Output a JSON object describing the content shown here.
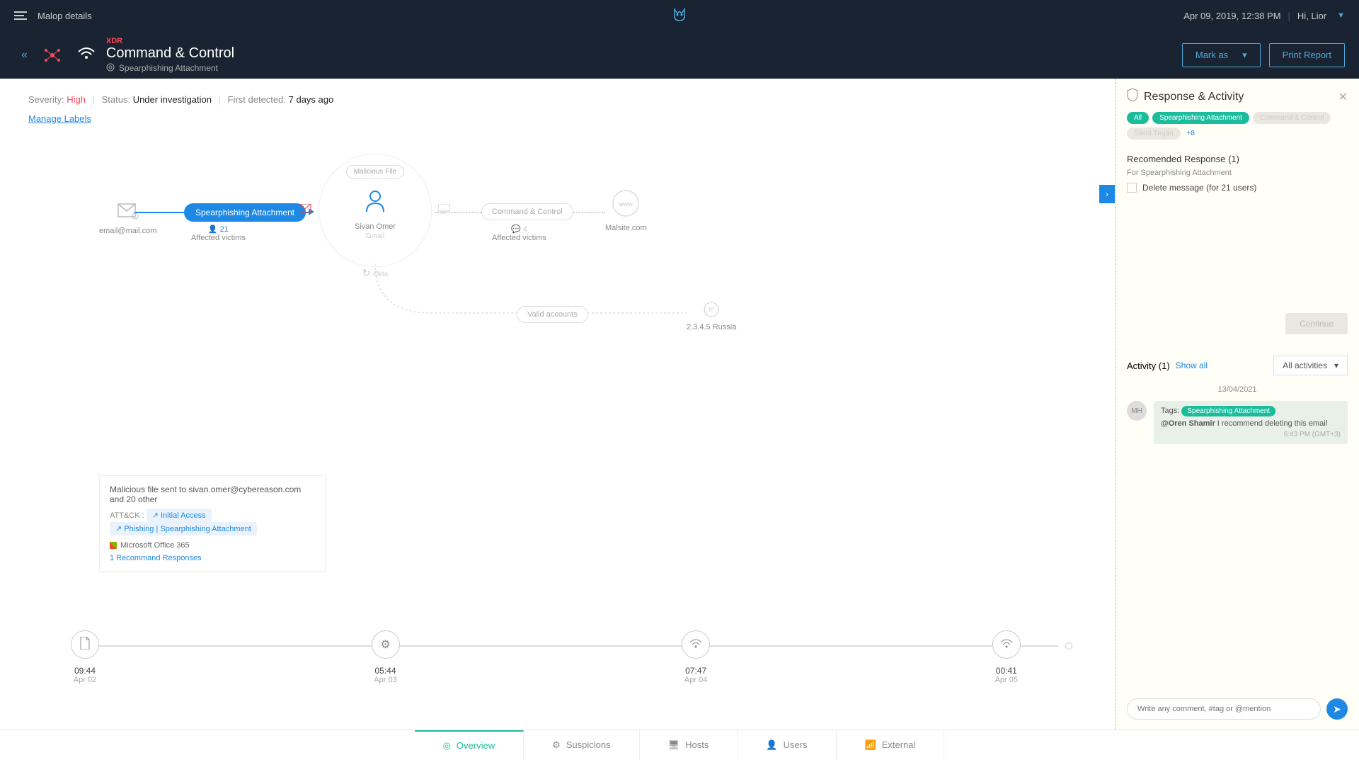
{
  "topbar": {
    "page": "Malop details",
    "datetime": "Apr 09, 2019, 12:38 PM",
    "greeting": "Hi, Lior"
  },
  "header": {
    "badge": "XDR",
    "title": "Command & Control",
    "subtitle": "Spearphishing Attachment",
    "mark_as": "Mark as",
    "print": "Print Report"
  },
  "status": {
    "sev_label": "Severity:",
    "sev_val": "High",
    "status_label": "Status:",
    "status_val": "Under investigation",
    "detected_label": "First detected:",
    "detected_val": "7 days ago",
    "manage": "Manage Labels"
  },
  "graph": {
    "email": "email@mail.com",
    "pill_main": "Spearphishing Attachment",
    "aff_count": "21",
    "aff_label": "Affected victims",
    "center_badge": "Malicious File",
    "center_name": "Sivan Omer",
    "center_sub": "Gmail",
    "center_bottom": "Okta",
    "cc_label": "Command & Control",
    "cc_count": "4",
    "cc_sub": "Affected victims",
    "www_label": "Malsite.com",
    "valid_acc": "Valid accounts",
    "ip_label": "2.3.4.5 Russia"
  },
  "card": {
    "title": "Malicious file sent to sivan.omer@cybereason.com and 20 other",
    "attck": "ATT&CK :",
    "tag1": "Initial Access",
    "tag2": "Phishing | Spearphishing Attachment",
    "source": "Microsoft Office 365",
    "rec": "1 Recommand Responses"
  },
  "timeline": [
    {
      "time": "09:44",
      "date": "Apr 02",
      "icon": "file"
    },
    {
      "time": "05:44",
      "date": "Apr 03",
      "icon": "gear"
    },
    {
      "time": "07:47",
      "date": "Apr 04",
      "icon": "wifi"
    },
    {
      "time": "00:41",
      "date": "Apr 05",
      "icon": "wifi"
    }
  ],
  "panel": {
    "title": "Response & Activity",
    "tags": {
      "all": "All",
      "sp": "Spearphishing Attachment",
      "m1": "Command & Control",
      "m2": "Silent Trojan",
      "more": "+8"
    },
    "rec_title": "Recomended Response (1)",
    "rec_sub": "For Spearphishing Attachment",
    "rec_item": "Delete message (for 21 users)",
    "continue": "Continue",
    "act_title": "Activity (1)",
    "show_all": "Show all",
    "filter": "All activities",
    "act_date": "13/04/2021",
    "avatar": "MH",
    "bubble_tags_label": "Tags:",
    "bubble_tag": "Spearphishing Attachment",
    "bubble_mention": "@Oren Shamir",
    "bubble_msg": " I recommend deleting this email",
    "bubble_time": "6:43 PM (GMT+3)",
    "input_ph": "Write any comment, #tag or @mention"
  },
  "tabs": {
    "overview": "Overview",
    "suspicions": "Suspicions",
    "hosts": "Hosts",
    "users": "Users",
    "external": "External"
  }
}
